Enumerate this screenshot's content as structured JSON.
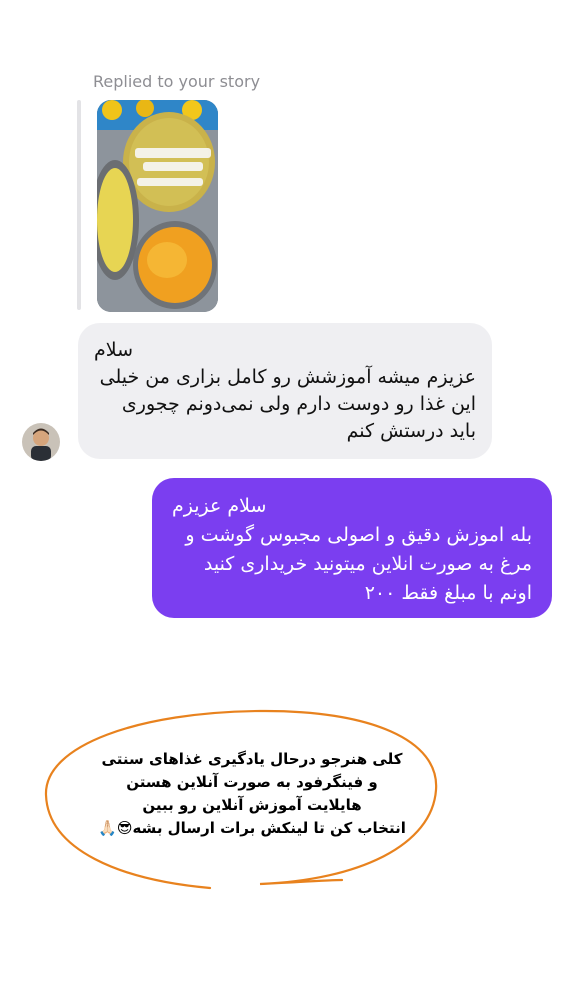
{
  "reply": {
    "label": "Replied to your story"
  },
  "incoming": {
    "greeting": "سلام",
    "lines": [
      "عزیزم میشه آموزشش رو کامل بزاری من خیلی",
      "این غذا رو دوست دارم ولی نمی‌دونم چجوری",
      "باید درستش کنم"
    ]
  },
  "outgoing": {
    "greeting": "سلام عزیزم",
    "lines": [
      "بله اموزش دقیق و اصولی مجبوس گوشت و",
      "مرغ به صورت انلاین میتونید خریداری کنید",
      "اونم با مبلغ فقط ۲۰۰"
    ]
  },
  "annotation": {
    "lines": [
      "کلی هنرجو درحال یادگیری  غذاهای سنتی",
      "و فینگرفود به صورت آنلاین هستن",
      "هایلایت آموزش آنلاین رو ببین",
      "انتخاب کن تا لینکش برات ارسال بشه😎🙏🏻"
    ],
    "circle_color": "#e8821e"
  },
  "colors": {
    "incoming_bubble": "#efeff2",
    "outgoing_bubble": "#7b3ef0",
    "label_gray": "#8e8e93"
  }
}
